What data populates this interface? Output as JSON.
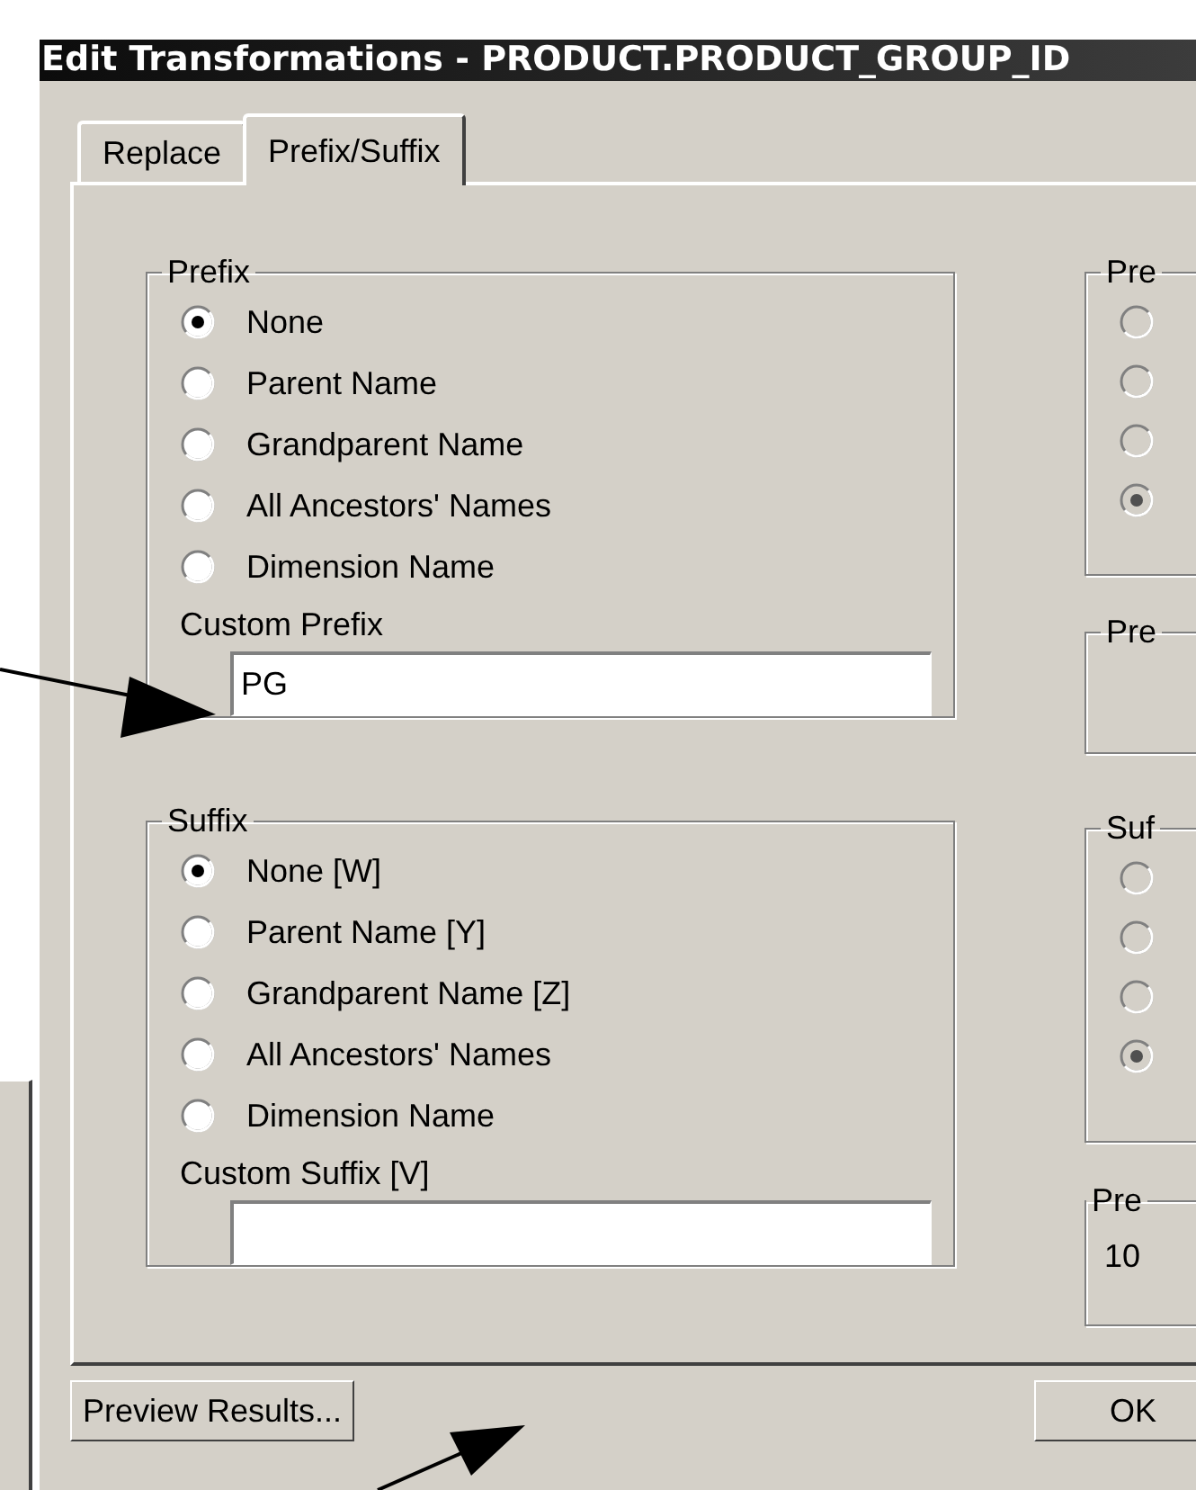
{
  "window": {
    "title": "Edit Transformations - PRODUCT.PRODUCT_GROUP_ID"
  },
  "tabs": [
    {
      "label": "Replace",
      "selected": false
    },
    {
      "label": "Prefix/Suffix",
      "selected": true
    }
  ],
  "prefix": {
    "title": "Prefix",
    "options": [
      {
        "label": "None",
        "selected": true
      },
      {
        "label": "Parent Name",
        "selected": false
      },
      {
        "label": "Grandparent Name",
        "selected": false
      },
      {
        "label": "All Ancestors' Names",
        "selected": false
      },
      {
        "label": "Dimension Name",
        "selected": false
      }
    ],
    "custom_label": "Custom Prefix",
    "custom_value": "PG"
  },
  "suffix": {
    "title": "Suffix",
    "options": [
      {
        "label": "None [W]",
        "selected": true
      },
      {
        "label": "Parent Name [Y]",
        "selected": false
      },
      {
        "label": "Grandparent Name [Z]",
        "selected": false
      },
      {
        "label": "All Ancestors' Names",
        "selected": false
      },
      {
        "label": "Dimension Name",
        "selected": false
      }
    ],
    "custom_label": "Custom Suffix [V]"
  },
  "right_groups": [
    {
      "title": "Pre",
      "options": [
        {
          "selected": false,
          "disabled": true
        },
        {
          "selected": false,
          "disabled": true
        },
        {
          "selected": false,
          "disabled": true
        },
        {
          "selected": true,
          "disabled": true
        }
      ]
    },
    {
      "title": "Pre"
    },
    {
      "title": "Suf",
      "options": [
        {
          "selected": false,
          "disabled": true
        },
        {
          "selected": false,
          "disabled": true
        },
        {
          "selected": false,
          "disabled": true
        },
        {
          "selected": true,
          "disabled": true
        }
      ]
    },
    {
      "title": "Pre",
      "text": "10"
    }
  ],
  "buttons": [
    {
      "label": "Preview Results..."
    },
    {
      "label": "OK"
    }
  ]
}
